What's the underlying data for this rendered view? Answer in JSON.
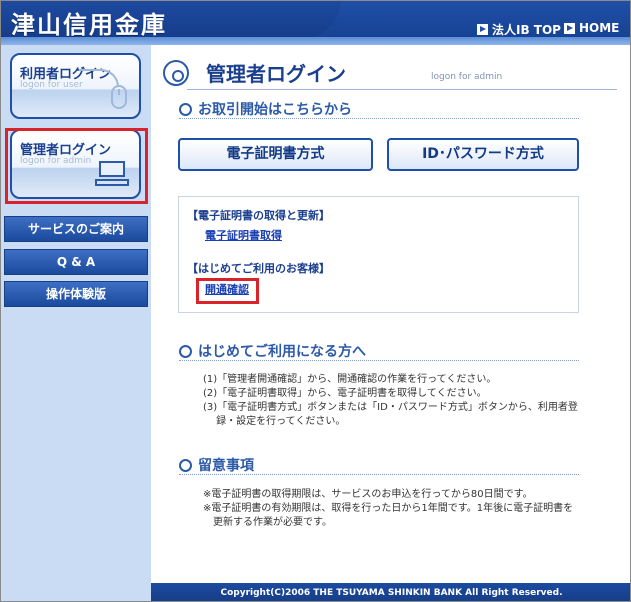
{
  "header": {
    "brand": "津山信用金庫",
    "links": [
      {
        "label": "法人IB TOP"
      },
      {
        "label": "HOME"
      }
    ]
  },
  "sidebar": {
    "user_login": {
      "title": "利用者ログイン",
      "subtitle": "logon for user"
    },
    "admin_login": {
      "title": "管理者ログイン",
      "subtitle": "logon for admin"
    },
    "nav": [
      {
        "label": "サービスのご案内"
      },
      {
        "label": "Q & A"
      },
      {
        "label": "操作体験版"
      }
    ]
  },
  "main": {
    "title": "管理者ログイン",
    "title_sub": "logon for admin",
    "section1": {
      "heading": "お取引開始はこちらから"
    },
    "buttons": {
      "cert": "電子証明書方式",
      "id": "ID･パスワード方式"
    },
    "box": {
      "label1": "【電子証明書の取得と更新】",
      "link1": "電子証明書取得",
      "label2": "【はじめてご利用のお客様】",
      "link2": "開通確認"
    },
    "section2": {
      "heading": "はじめてご利用になる方へ",
      "lines": [
        "(1)「管理者開通確認」から、開通確認の作業を行ってください。",
        "(2)「電子証明書取得」から、電子証明書を取得してください。",
        "(3)「電子証明書方式」ボタンまたは「ID・パスワード方式」ボタンから、利用者登",
        "　 録・設定を行ってください。"
      ]
    },
    "section3": {
      "heading": "留意事項",
      "lines": [
        "※電子証明書の取得期限は、サービスのお申込を行ってから80日間です。",
        "※電子証明書の有効期限は、取得を行った日から1年間です。1年後に電子証明書を",
        "　更新する作業が必要です。"
      ]
    }
  },
  "footer": {
    "copyright": "Copyright(C)2006 THE TSUYAMA SHINKIN BANK All Right Reserved."
  },
  "colors": {
    "brand_blue": "#1f4fa8",
    "highlight_red": "#d8232a",
    "sidebar_bg": "#c9dcf3"
  }
}
